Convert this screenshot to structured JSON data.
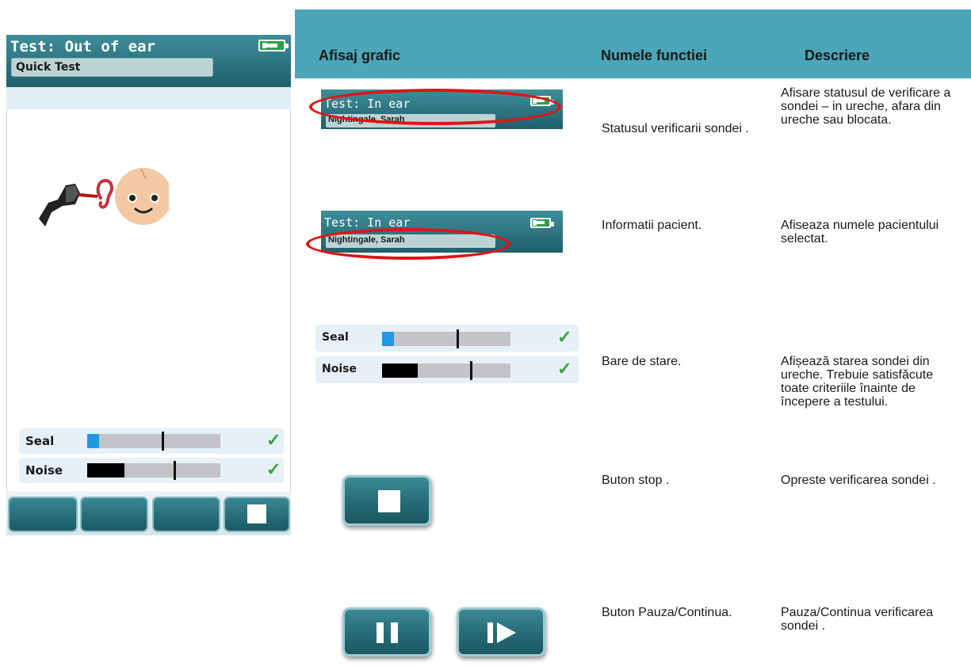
{
  "device": {
    "title": "Test: Out of ear",
    "patient": "Quick Test",
    "seal_label": "Seal",
    "noise_label": "Noise",
    "seal_level": 0.09,
    "noise_level": 0.28,
    "check_glyph": "✓",
    "icons": [
      "battery-icon",
      "probe-icon",
      "ear-icon",
      "baby-face-icon",
      "check-icon",
      "stop-icon"
    ],
    "colors": {
      "header": "#2c7480",
      "seal_fill": "#1e9be0",
      "noise_fill": "#000000",
      "check": "#3aa13a"
    }
  },
  "table": {
    "headers": {
      "graphic": "Afisaj grafic",
      "function": "Numele functiei",
      "description": "Descriere"
    },
    "header_color": "#4aa6b8",
    "rows": [
      {
        "function": "Statusul verificarii sondei .",
        "description": "Afisare statusul de verificare a sondei – in ureche, afara din ureche sau blocata.",
        "mini_title": "Test: In ear",
        "mini_patient": "Nightingale, Sarah"
      },
      {
        "function": "Informatii pacient.",
        "description": "Afiseaza numele pacientului selectat.",
        "mini_title": "Test: In ear",
        "mini_patient": "Nightingale, Sarah"
      },
      {
        "function": "Bare de stare.",
        "description": "Afișează starea sondei din ureche. Trebuie satisfăcute toate criteriile înainte de începere a testului.",
        "seal_label": "Seal",
        "noise_label": "Noise"
      },
      {
        "function": "Buton stop .",
        "description": "Opreste verificarea sondei ."
      },
      {
        "function": "Buton Pauza/Continua.",
        "description": "Pauza/Continua verificarea sondei ."
      }
    ]
  }
}
